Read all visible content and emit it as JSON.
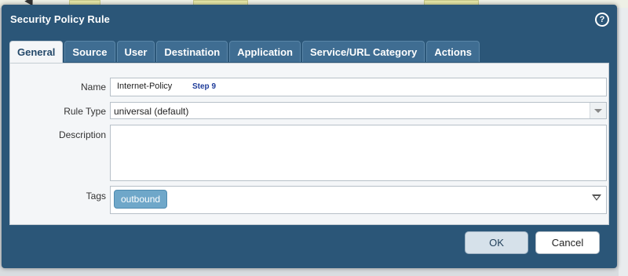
{
  "dialog": {
    "title": "Security Policy Rule",
    "help_icon": "question-circle-icon"
  },
  "tabs": [
    {
      "label": "General",
      "active": true
    },
    {
      "label": "Source",
      "active": false
    },
    {
      "label": "User",
      "active": false
    },
    {
      "label": "Destination",
      "active": false
    },
    {
      "label": "Application",
      "active": false
    },
    {
      "label": "Service/URL Category",
      "active": false
    },
    {
      "label": "Actions",
      "active": false
    }
  ],
  "general": {
    "name": {
      "label": "Name",
      "value": "Internet-Policy",
      "annotation": "Step 9"
    },
    "rule_type": {
      "label": "Rule Type",
      "value": "universal (default)"
    },
    "description": {
      "label": "Description",
      "value": ""
    },
    "tags": {
      "label": "Tags",
      "values": [
        "outbound"
      ]
    }
  },
  "footer": {
    "ok_label": "OK",
    "cancel_label": "Cancel"
  },
  "colors": {
    "dialog_bg": "#2b5678",
    "tab_bg": "#3f6d92",
    "panel_bg": "#f4f6f8",
    "tag_bg": "#6fa7c9"
  }
}
